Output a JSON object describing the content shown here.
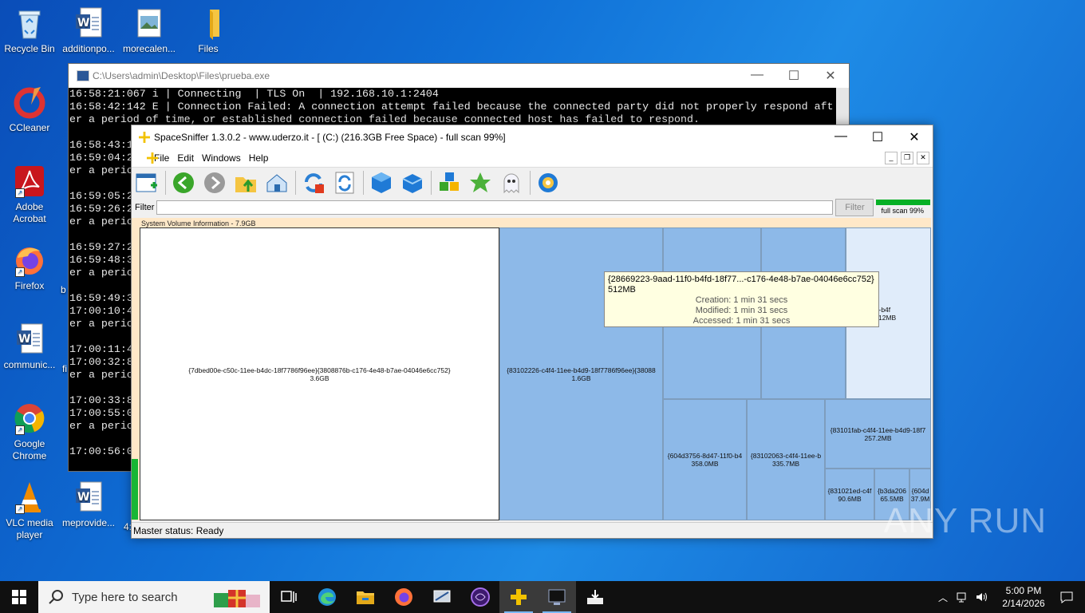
{
  "desktop": {
    "icons": [
      {
        "label": "Recycle Bin"
      },
      {
        "label": "additionpo..."
      },
      {
        "label": "morecalen..."
      },
      {
        "label": "Files"
      },
      {
        "label": "CCleaner"
      },
      {
        "label": "Adobe Acrobat"
      },
      {
        "label": "Firefox"
      },
      {
        "label": "communic..."
      },
      {
        "label": "Google Chrome"
      },
      {
        "label": "VLC media player"
      },
      {
        "label": "meprovide..."
      }
    ],
    "partial_labels": {
      "b": "b",
      "fi": "fi",
      "n4": "4:"
    }
  },
  "console": {
    "title": "C:\\Users\\admin\\Desktop\\Files\\prueba.exe",
    "controls": {
      "min": "—",
      "max": "☐",
      "close": "✕"
    },
    "lines": "16:58:21:067 i | Connecting  | TLS On  | 192.168.10.1:2404\n16:58:42:142 E | Connection Failed: A connection attempt failed because the connected party did not properly respond aft\ner a period of time, or established connection failed because connected host has failed to respond.\n\n16:58:43:1\n16:59:04:2\ner a perio\n\n16:59:05:2\n16:59:26:2\ner a perio\n\n16:59:27:2\n16:59:48:3\ner a perio\n\n16:59:49:3\n17:00:10:4\ner a perio\n\n17:00:11:4\n17:00:32:8\ner a perio\n\n17:00:33:8\n17:00:55:0\ner a perio\n\n17:00:56:0"
  },
  "spacesniffer": {
    "title": "SpaceSniffer 1.3.0.2 - www.uderzo.it - [ (C:) (216.3GB Free Space) - full scan 99%]",
    "controls": {
      "min": "—",
      "max": "☐",
      "close": "✕"
    },
    "menu": [
      "File",
      "Edit",
      "Windows",
      "Help"
    ],
    "mdi": {
      "min": "_",
      "restore": "❐",
      "close": "✕"
    },
    "filter_label": "Filter",
    "filter_value": "",
    "filter_button": "Filter",
    "progress": {
      "label": "full scan 99%",
      "value": 0.99
    },
    "map_header": "System Volume Information - 7.9GB",
    "blocks": [
      {
        "name": "{7dbed00e-c50c-11ee-b4dc-18f7786f96ee}{3808876b-c176-4e48-b7ae-04046e6cc752}",
        "size": "3.6GB"
      },
      {
        "name": "{83102226-c4f4-11ee-b4d9-18f7786f96ee}{38088",
        "size": "1.6GB"
      },
      {
        "name": "-9aad-11f0-b4f",
        "size": "12MB"
      },
      {
        "name": "{604d3756-8d47-11f0-b4",
        "size": "358.0MB"
      },
      {
        "name": "{83102063-c4f4-11ee-b",
        "size": "335.7MB"
      },
      {
        "name": "{83101fab-c4f4-11ee-b4d9-18f7",
        "size": "257.2MB"
      },
      {
        "name": "{831021ed-c4f",
        "size": "90.6MB"
      },
      {
        "name": "{b3da206",
        "size": "65.5MB"
      },
      {
        "name": "{604d",
        "size": "37.9M"
      }
    ],
    "tooltip": {
      "name": "{28669223-9aad-11f0-b4fd-18f77...-c176-4e48-b7ae-04046e6cc752}",
      "size": "512MB",
      "creation": "Creation: 1 min 31 secs",
      "modified": "Modified: 1 min 31 secs",
      "accessed": "Accessed: 1 min 31 secs"
    },
    "status": "Master status: Ready"
  },
  "taskbar": {
    "search_placeholder": "Type here to search",
    "time": "5:00 PM",
    "date": "2/14/2026"
  },
  "watermark": "ANY RUN"
}
